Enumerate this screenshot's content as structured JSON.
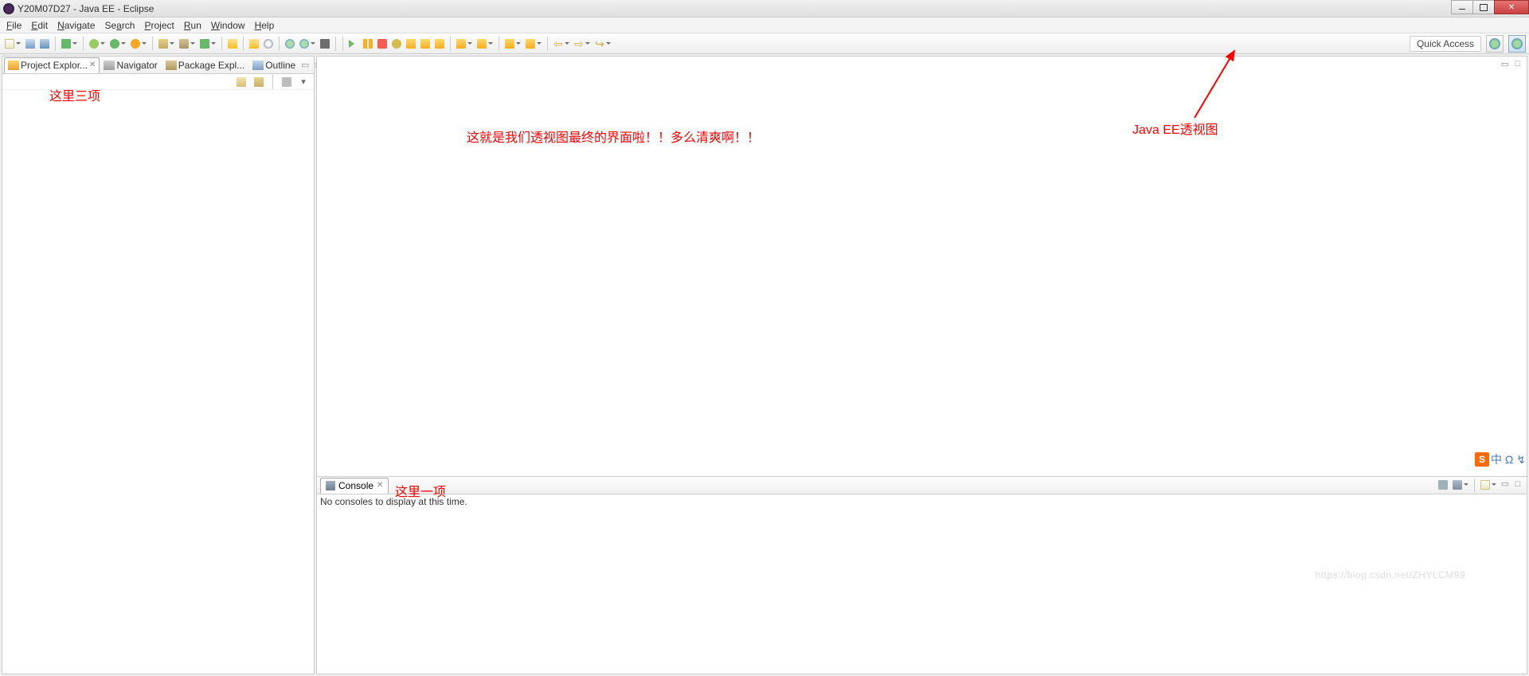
{
  "window": {
    "title": "Y20M07D27 - Java EE - Eclipse"
  },
  "menu": {
    "items": [
      "File",
      "Edit",
      "Navigate",
      "Search",
      "Project",
      "Run",
      "Window",
      "Help"
    ]
  },
  "toolbar": {
    "quick_access": "Quick Access"
  },
  "left_panel": {
    "tabs": [
      {
        "label": "Project Explor...",
        "active": true
      },
      {
        "label": "Navigator",
        "active": false
      },
      {
        "label": "Package Expl...",
        "active": false
      },
      {
        "label": "Outline",
        "active": false
      }
    ]
  },
  "console": {
    "tab_label": "Console",
    "message": "No consoles to display at this time."
  },
  "annotations": {
    "left": "这里三项",
    "center": "这就是我们透视图最终的界面啦！！多么清爽啊！！",
    "right": "Java EE透视图",
    "bottom": "这里一项"
  },
  "ime": {
    "badge": "S",
    "chars": "中 Ω ↯"
  },
  "watermark": "https://blog.csdn.net/ZHYLCM99"
}
